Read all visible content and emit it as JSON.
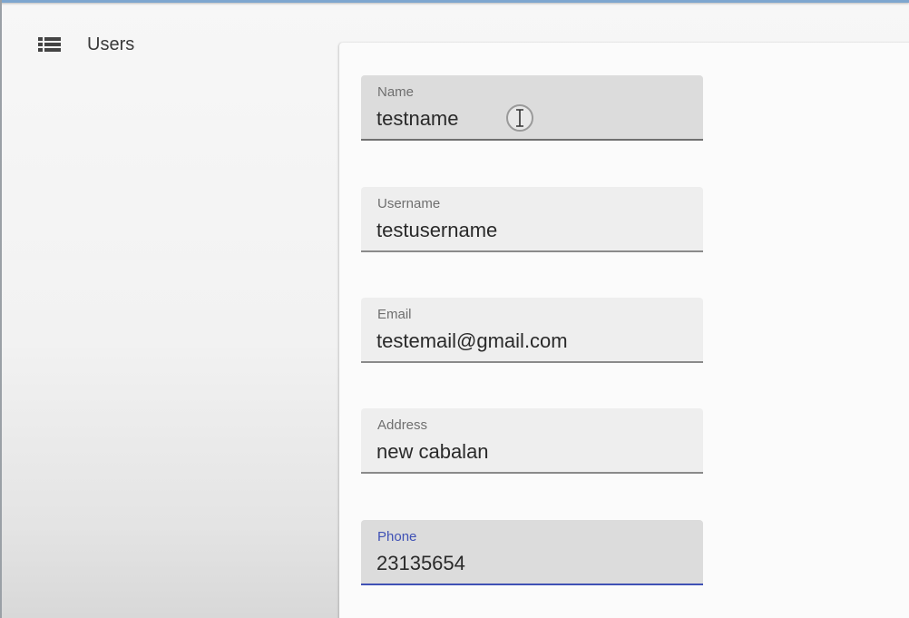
{
  "sidebar": {
    "items": [
      {
        "label": "Users",
        "icon": "list-icon"
      }
    ]
  },
  "form": {
    "fields": [
      {
        "label": "Name",
        "value": "testname"
      },
      {
        "label": "Username",
        "value": "testusername"
      },
      {
        "label": "Email",
        "value": "testemail@gmail.com"
      },
      {
        "label": "Address",
        "value": "new cabalan"
      },
      {
        "label": "Phone",
        "value": "23135654"
      }
    ]
  },
  "colors": {
    "accent": "#3f51b5",
    "top_bar": "#7ea6cf",
    "field_background": "#eeeeee",
    "text": "#2a2a2a"
  },
  "cursor": {
    "icon": "text-cursor-icon"
  }
}
